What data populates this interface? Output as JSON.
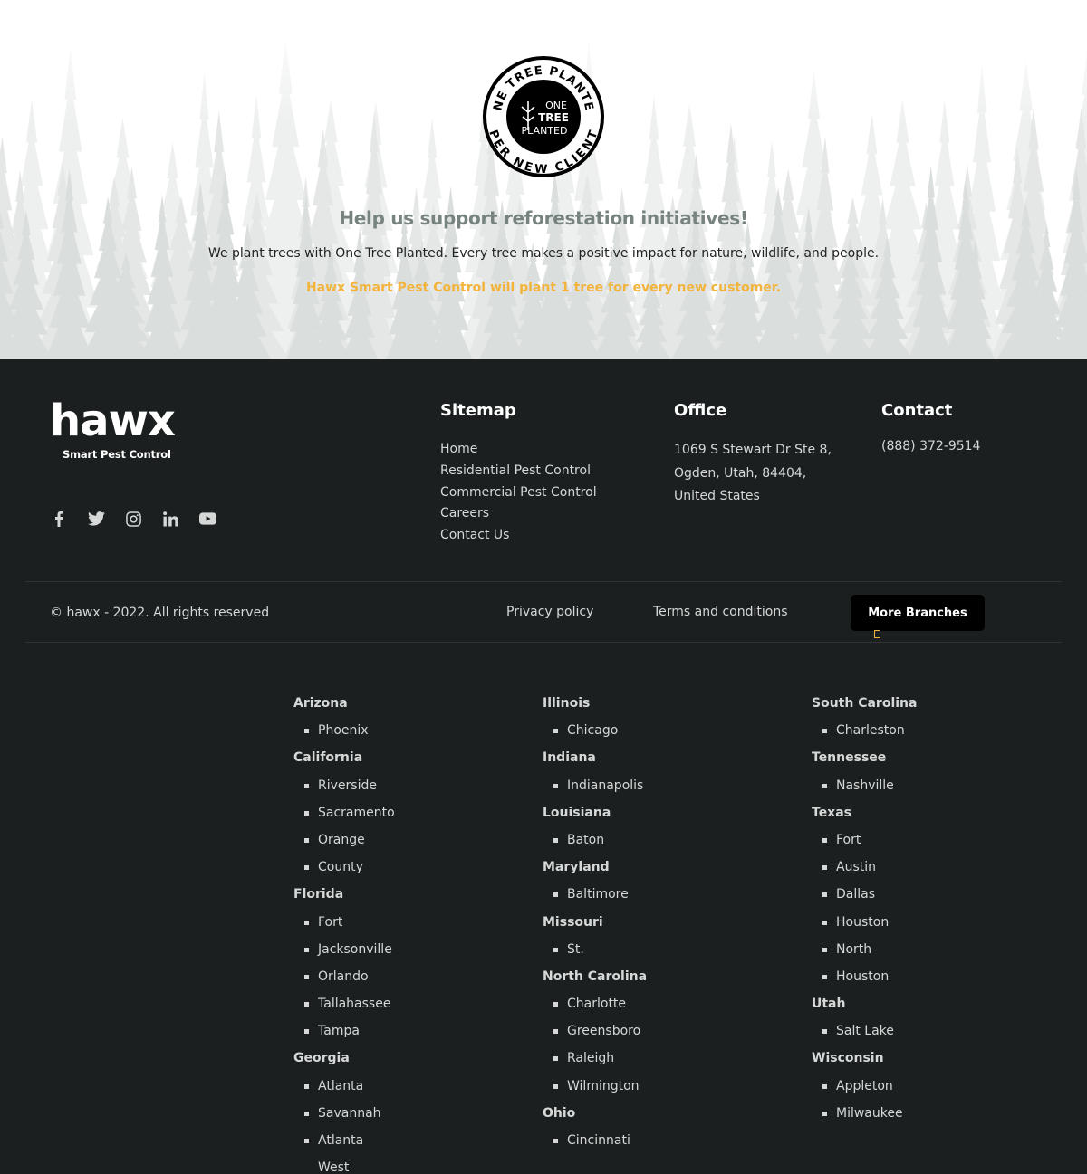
{
  "hero": {
    "badge": {
      "ring_text_top": "ONE TREE PLANTED",
      "ring_text_bottom": "PER NEW CLIENT",
      "center_line1": "ONE",
      "center_line2": "TREE",
      "center_line3": "PLANTED"
    },
    "title": "Help us support reforestation initiatives!",
    "text": "We plant trees with One Tree Planted. Every tree makes a positive impact for nature, wildlife, and people.",
    "cta": "Hawx Smart Pest Control will plant 1 tree for every new customer."
  },
  "footer": {
    "logo": {
      "word": "hawx",
      "tagline": "Smart Pest Control"
    },
    "socials": [
      "facebook-icon",
      "twitter-icon",
      "instagram-icon",
      "linkedin-icon",
      "youtube-icon"
    ],
    "sitemap": {
      "title": "Sitemap",
      "links": [
        "Home",
        "Residential Pest Control",
        "Commercial Pest Control",
        "Careers",
        "Contact Us"
      ]
    },
    "office": {
      "title": "Office",
      "line1": "1069 S Stewart Dr Ste 8,",
      "line2": "Ogden, Utah, 84404,",
      "line3": "United States"
    },
    "contact": {
      "title": "Contact",
      "phone": "(888) 372-9514"
    },
    "bottom": {
      "copyright": "© hawx - 2022. All rights reserved",
      "privacy": "Privacy policy",
      "terms": "Terms and conditions",
      "more_branches": "More Branches"
    },
    "colors": {
      "background": "#1b1f1f",
      "accent": "#f2b43c",
      "title_gray": "#77837f"
    }
  },
  "branches": {
    "col1": [
      {
        "t": "state",
        "v": "Arizona"
      },
      {
        "t": "city",
        "v": "Phoenix"
      },
      {
        "t": "state",
        "v": "California"
      },
      {
        "t": "city",
        "v": "Riverside"
      },
      {
        "t": "city",
        "v": "Sacramento"
      },
      {
        "t": "city",
        "v": "Orange"
      },
      {
        "t": "city",
        "v": "County"
      },
      {
        "t": "state",
        "v": "Florida"
      },
      {
        "t": "city",
        "v": "Fort"
      },
      {
        "t": "city",
        "v": "Jacksonville"
      },
      {
        "t": "city",
        "v": "Orlando"
      },
      {
        "t": "city",
        "v": "Tallahassee"
      },
      {
        "t": "city",
        "v": "Tampa"
      },
      {
        "t": "state",
        "v": "Georgia"
      },
      {
        "t": "city",
        "v": "Atlanta"
      },
      {
        "t": "city",
        "v": "Savannah"
      },
      {
        "t": "city",
        "v": "Atlanta"
      },
      {
        "t": "cont",
        "v": "West"
      }
    ],
    "col2": [
      {
        "t": "state",
        "v": "Illinois"
      },
      {
        "t": "city",
        "v": "Chicago"
      },
      {
        "t": "state",
        "v": "Indiana"
      },
      {
        "t": "city",
        "v": "Indianapolis"
      },
      {
        "t": "state",
        "v": "Louisiana"
      },
      {
        "t": "city",
        "v": "Baton"
      },
      {
        "t": "state",
        "v": "Maryland"
      },
      {
        "t": "city",
        "v": "Baltimore"
      },
      {
        "t": "state",
        "v": "Missouri"
      },
      {
        "t": "city",
        "v": "St."
      },
      {
        "t": "state",
        "v": "North Carolina"
      },
      {
        "t": "city",
        "v": "Charlotte"
      },
      {
        "t": "city",
        "v": "Greensboro"
      },
      {
        "t": "city",
        "v": "Raleigh"
      },
      {
        "t": "city",
        "v": "Wilmington"
      },
      {
        "t": "state",
        "v": "Ohio"
      },
      {
        "t": "city",
        "v": "Cincinnati"
      }
    ],
    "col3": [
      {
        "t": "state",
        "v": "South Carolina"
      },
      {
        "t": "city",
        "v": "Charleston"
      },
      {
        "t": "state",
        "v": "Tennessee"
      },
      {
        "t": "city",
        "v": "Nashville"
      },
      {
        "t": "state",
        "v": "Texas"
      },
      {
        "t": "city",
        "v": "Fort"
      },
      {
        "t": "city",
        "v": "Austin"
      },
      {
        "t": "city",
        "v": "Dallas"
      },
      {
        "t": "city",
        "v": "Houston"
      },
      {
        "t": "city",
        "v": "North"
      },
      {
        "t": "city",
        "v": "Houston"
      },
      {
        "t": "state",
        "v": "Utah"
      },
      {
        "t": "city",
        "v": "Salt Lake"
      },
      {
        "t": "state",
        "v": "Wisconsin"
      },
      {
        "t": "city",
        "v": "Appleton"
      },
      {
        "t": "city",
        "v": "Milwaukee"
      }
    ]
  }
}
